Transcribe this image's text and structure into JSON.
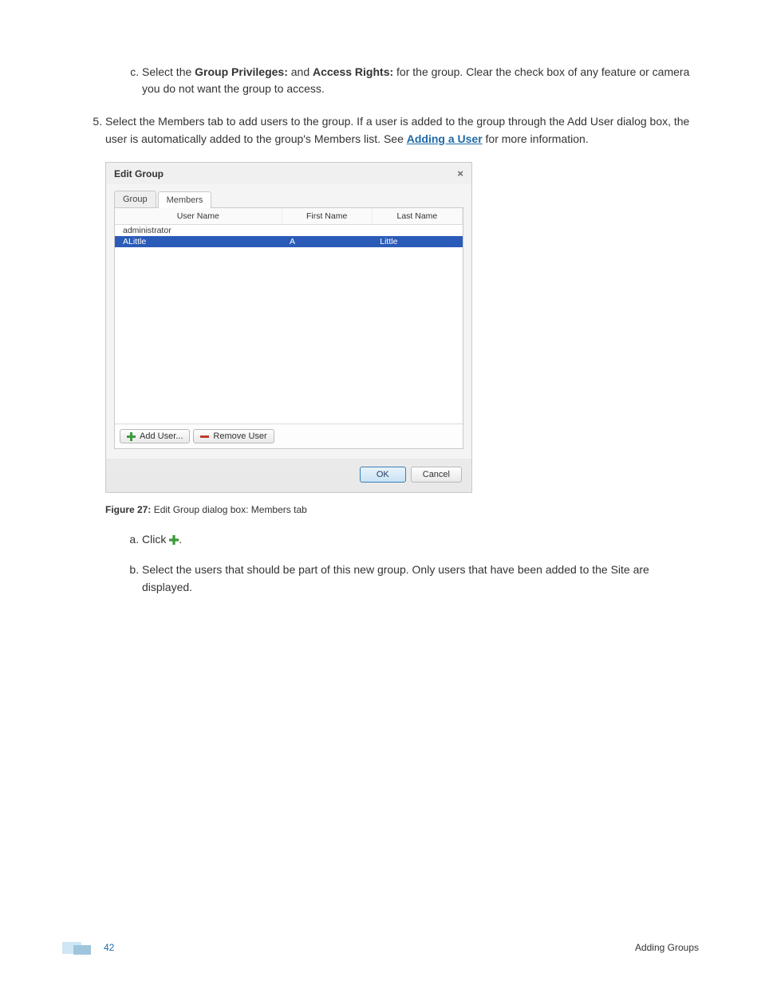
{
  "step_c": {
    "prefix": "Select the ",
    "bold1": "Group Privileges:",
    "mid": " and ",
    "bold2": "Access Rights:",
    "suffix": " for the group. Clear the check box of any feature or camera you do not want the group to access."
  },
  "step_5": {
    "prefix": "Select the Members tab to add users to the group. If a user is added to the group through the Add User dialog box, the user is automatically added to the group's Members list. See ",
    "link": "Adding a User",
    "suffix": " for more information."
  },
  "dialog": {
    "title": "Edit Group",
    "tabs": {
      "group": "Group",
      "members": "Members"
    },
    "columns": {
      "user": "User Name",
      "first": "First Name",
      "last": "Last Name"
    },
    "rows": [
      {
        "user": "administrator",
        "first": "",
        "last": "",
        "selected": false
      },
      {
        "user": "ALittle",
        "first": "A",
        "last": "Little",
        "selected": true
      }
    ],
    "buttons": {
      "add": "Add User...",
      "remove": "Remove User",
      "ok": "OK",
      "cancel": "Cancel"
    }
  },
  "figure": {
    "label": "Figure 27:",
    "caption": " Edit Group dialog box: Members tab"
  },
  "sub_a": "Click ",
  "sub_a_suffix": ".",
  "sub_b": "Select the users that should be part of this new group. Only users that have been added to the Site are displayed.",
  "footer": {
    "page": "42",
    "section": "Adding Groups"
  }
}
